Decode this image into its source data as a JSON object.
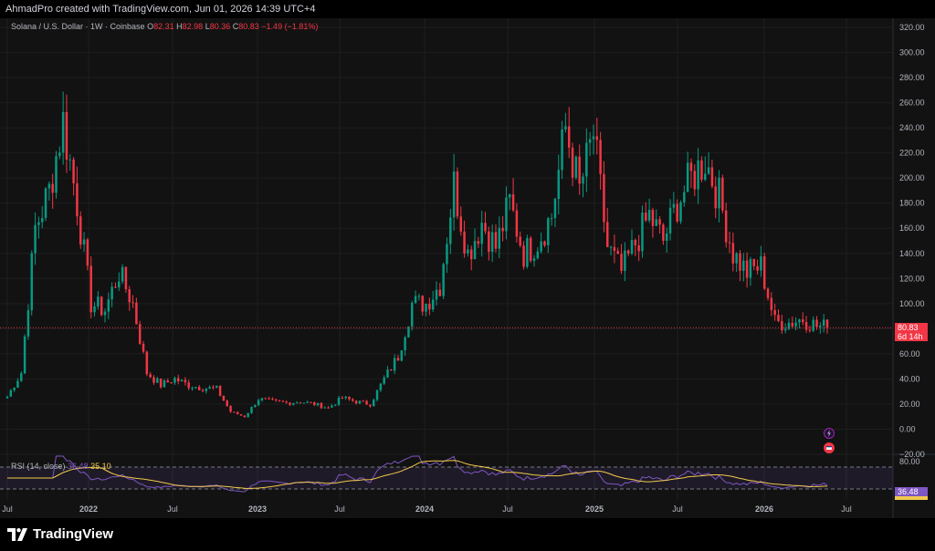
{
  "header": {
    "created_by": "AhmadPro created with TradingView.com, Jun 01, 2026 14:39 UTC+4"
  },
  "legend": {
    "symbol": "Solana / U.S. Dollar · 1W · Coinbase",
    "open_label": "O",
    "open": "82.31",
    "high_label": "H",
    "high": "82.98",
    "low_label": "L",
    "low": "80.36",
    "close_label": "C",
    "close": "80.83",
    "change": "−1.49 (−1.81%)"
  },
  "rsi_legend": {
    "name": "RSI (14, close)",
    "rsi_value": "36.48",
    "ma_value": "35.10"
  },
  "price_tag": {
    "price": "80.83",
    "countdown": "6d 14h"
  },
  "rsi_tag": {
    "value": "36.48"
  },
  "footer": {
    "brand": "TradingView"
  },
  "colors": {
    "up": "#089981",
    "down": "#f23645",
    "rsi": "#7e57c2",
    "rsi_ma": "#f2c94c",
    "background": "#121212",
    "grid": "#1e1e1e"
  },
  "icons": [
    "lightning-icon",
    "calendar-flag-icon"
  ],
  "chart_data": [
    {
      "type": "candlestick",
      "title": "Solana / U.S. Dollar · 1W · Coinbase",
      "ylim": [
        -20,
        320
      ],
      "y_ticks": [
        "320.00",
        "300.00",
        "280.00",
        "260.00",
        "240.00",
        "220.00",
        "200.00",
        "180.00",
        "160.00",
        "140.00",
        "120.00",
        "100.00",
        "80.00",
        "60.00",
        "40.00",
        "20.00",
        "0.00",
        "−20.00"
      ],
      "x_labels": [
        "Jul",
        "2022",
        "Jul",
        "2023",
        "Jul",
        "2024",
        "Jul",
        "2025",
        "Jul",
        "2026",
        "Jul"
      ],
      "grid": true,
      "last_close": 80.83,
      "series_close_approx": [
        {
          "t": "2021-07",
          "close": 26
        },
        {
          "t": "2021-08",
          "close": 45
        },
        {
          "t": "2021-09",
          "close": 160
        },
        {
          "t": "2021-10",
          "close": 190
        },
        {
          "t": "2021-11",
          "close": 245
        },
        {
          "t": "2021-12",
          "close": 180
        },
        {
          "t": "2022-01",
          "close": 100
        },
        {
          "t": "2022-02",
          "close": 95
        },
        {
          "t": "2022-03",
          "close": 125
        },
        {
          "t": "2022-04",
          "close": 100
        },
        {
          "t": "2022-05",
          "close": 45
        },
        {
          "t": "2022-06",
          "close": 35
        },
        {
          "t": "2022-07",
          "close": 40
        },
        {
          "t": "2022-08",
          "close": 35
        },
        {
          "t": "2022-09",
          "close": 33
        },
        {
          "t": "2022-10",
          "close": 32
        },
        {
          "t": "2022-11",
          "close": 14
        },
        {
          "t": "2022-12",
          "close": 10
        },
        {
          "t": "2023-01",
          "close": 24
        },
        {
          "t": "2023-02",
          "close": 22
        },
        {
          "t": "2023-03",
          "close": 21
        },
        {
          "t": "2023-04",
          "close": 22
        },
        {
          "t": "2023-05",
          "close": 20
        },
        {
          "t": "2023-06",
          "close": 17
        },
        {
          "t": "2023-07",
          "close": 25
        },
        {
          "t": "2023-08",
          "close": 22
        },
        {
          "t": "2023-09",
          "close": 20
        },
        {
          "t": "2023-10",
          "close": 40
        },
        {
          "t": "2023-11",
          "close": 58
        },
        {
          "t": "2023-12",
          "close": 100
        },
        {
          "t": "2024-01",
          "close": 100
        },
        {
          "t": "2024-02",
          "close": 115
        },
        {
          "t": "2024-03",
          "close": 195
        },
        {
          "t": "2024-04",
          "close": 140
        },
        {
          "t": "2024-05",
          "close": 165
        },
        {
          "t": "2024-06",
          "close": 145
        },
        {
          "t": "2024-07",
          "close": 180
        },
        {
          "t": "2024-08",
          "close": 140
        },
        {
          "t": "2024-09",
          "close": 150
        },
        {
          "t": "2024-10",
          "close": 170
        },
        {
          "t": "2024-11",
          "close": 240
        },
        {
          "t": "2024-12",
          "close": 190
        },
        {
          "t": "2025-01",
          "close": 235
        },
        {
          "t": "2025-02",
          "close": 145
        },
        {
          "t": "2025-03",
          "close": 125
        },
        {
          "t": "2025-04",
          "close": 148
        },
        {
          "t": "2025-05",
          "close": 170
        },
        {
          "t": "2025-06",
          "close": 150
        },
        {
          "t": "2025-07",
          "close": 180
        },
        {
          "t": "2025-08",
          "close": 200
        },
        {
          "t": "2025-09",
          "close": 215
        },
        {
          "t": "2025-10",
          "close": 185
        },
        {
          "t": "2025-11",
          "close": 140
        },
        {
          "t": "2025-12",
          "close": 125
        },
        {
          "t": "2026-01",
          "close": 130
        },
        {
          "t": "2026-02",
          "close": 85
        },
        {
          "t": "2026-03",
          "close": 85
        },
        {
          "t": "2026-04",
          "close": 88
        },
        {
          "t": "2026-05",
          "close": 82
        },
        {
          "t": "2026-06",
          "close": 80.83
        }
      ]
    },
    {
      "type": "line",
      "title": "RSI (14, close)",
      "ylim": [
        10,
        90
      ],
      "y_ticks": [
        "80.00"
      ],
      "band": [
        30,
        70
      ],
      "series": [
        {
          "name": "RSI (14, close)",
          "last": 36.48
        },
        {
          "name": "",
          "last": 35.1
        }
      ]
    }
  ]
}
